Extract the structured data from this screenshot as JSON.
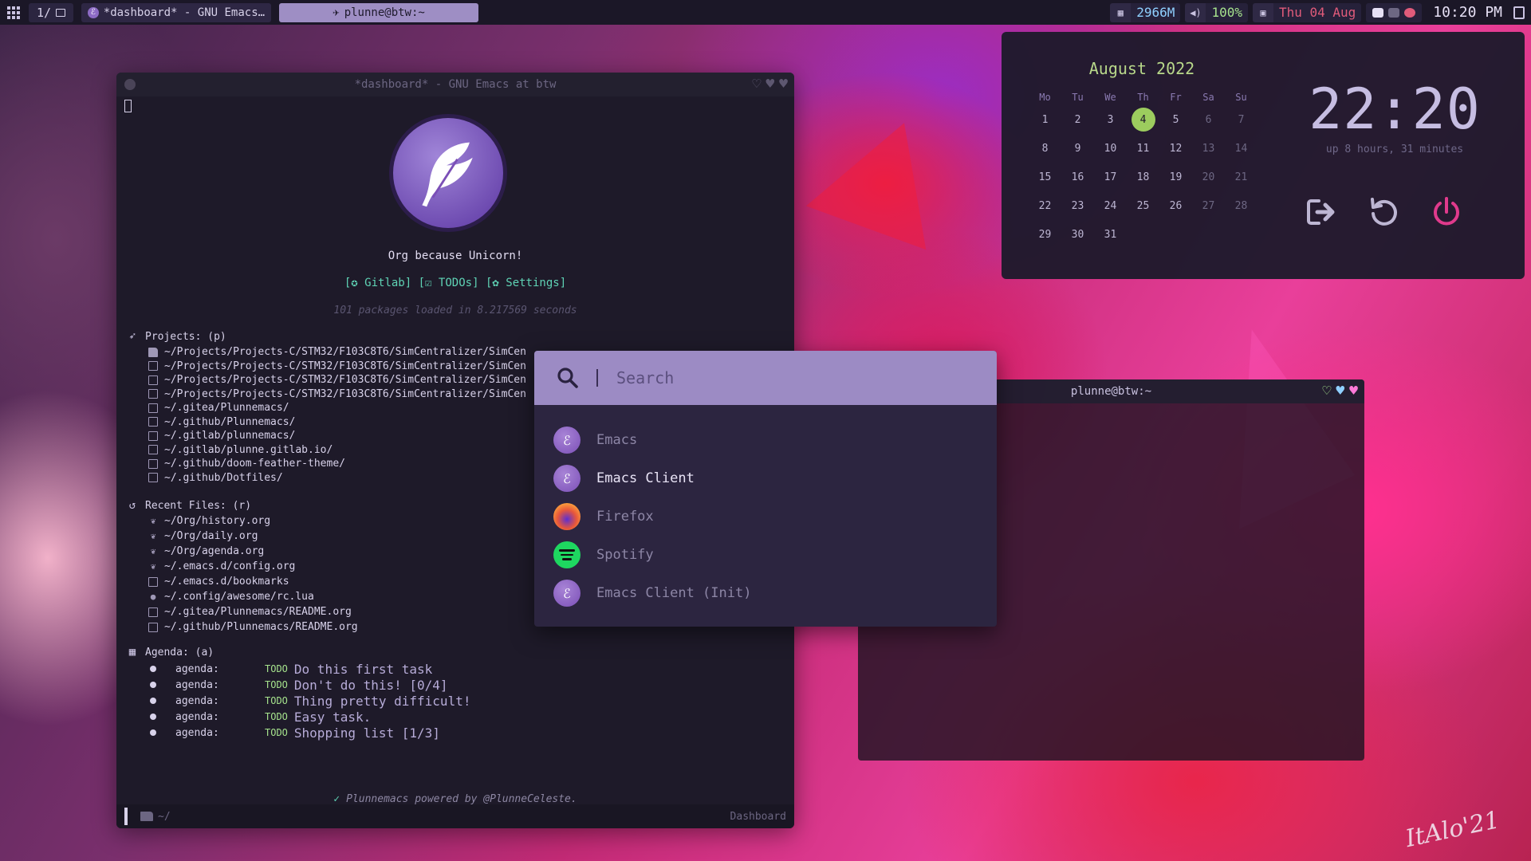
{
  "topbar": {
    "workspace": "1/",
    "tasks": [
      {
        "label": "*dashboard* - GNU Emacs…",
        "active": false
      },
      {
        "label": "plunne@btw:~",
        "active": true
      }
    ],
    "memory": "2966M",
    "volume": "100%",
    "date": "Thu 04 Aug",
    "time": "10:20 PM"
  },
  "emacs": {
    "title": "*dashboard* - GNU Emacs at btw",
    "tagline": "Org because Unicorn!",
    "links": [
      {
        "icon": "gitlab-icon",
        "label": "Gitlab"
      },
      {
        "icon": "check-icon",
        "label": "TODOs"
      },
      {
        "icon": "gear-icon",
        "label": "Settings"
      }
    ],
    "loaded": "101 packages loaded in 8.217569 seconds",
    "projects": {
      "heading": "Projects: (p)",
      "items": [
        "~/Projects/Projects-C/STM32/F103C8T6/SimCentralizer/SimCen",
        "~/Projects/Projects-C/STM32/F103C8T6/SimCentralizer/SimCen",
        "~/Projects/Projects-C/STM32/F103C8T6/SimCentralizer/SimCen",
        "~/Projects/Projects-C/STM32/F103C8T6/SimCentralizer/SimCen",
        "~/.gitea/Plunnemacs/",
        "~/.github/Plunnemacs/",
        "~/.gitlab/plunnemacs/",
        "~/.gitlab/plunne.gitlab.io/",
        "~/.github/doom-feather-theme/",
        "~/.github/Dotfiles/"
      ]
    },
    "recent": {
      "heading": "Recent Files: (r)",
      "items": [
        "~/Org/history.org",
        "~/Org/daily.org",
        "~/Org/agenda.org",
        "~/.emacs.d/config.org",
        "~/.emacs.d/bookmarks",
        "~/.config/awesome/rc.lua",
        "~/.gitea/Plunnemacs/README.org",
        "~/.github/Plunnemacs/README.org"
      ]
    },
    "agenda": {
      "heading": "Agenda: (a)",
      "items": [
        {
          "tag": "agenda:",
          "state": "TODO",
          "text": "Do this first task"
        },
        {
          "tag": "agenda:",
          "state": "TODO",
          "text": "Don't do this! [0/4]"
        },
        {
          "tag": "agenda:",
          "state": "TODO",
          "text": "Thing pretty difficult!"
        },
        {
          "tag": "agenda:",
          "state": "TODO",
          "text": "Easy task."
        },
        {
          "tag": "agenda:",
          "state": "TODO",
          "text": "Shopping list [1/3]"
        }
      ]
    },
    "footer": "Plunnemacs powered by @PlunneCeleste.",
    "modeline": {
      "path": "~/",
      "mode": "Dashboard"
    }
  },
  "terminal": {
    "title": "plunne@btw:~"
  },
  "calendar": {
    "title": "August 2022",
    "weekdays": [
      "Mo",
      "Tu",
      "We",
      "Th",
      "Fr",
      "Sa",
      "Su"
    ],
    "days": [
      "1",
      "2",
      "3",
      "4",
      "5",
      "6",
      "7",
      "8",
      "9",
      "10",
      "11",
      "12",
      "13",
      "14",
      "15",
      "16",
      "17",
      "18",
      "19",
      "20",
      "21",
      "22",
      "23",
      "24",
      "25",
      "26",
      "27",
      "28",
      "29",
      "30",
      "31"
    ],
    "today": "4"
  },
  "clock": {
    "time": "22:20",
    "uptime": "up 8 hours, 31 minutes"
  },
  "launcher": {
    "placeholder": "Search",
    "apps": [
      {
        "name": "Emacs",
        "icon": "emacs-icon",
        "selected": false
      },
      {
        "name": "Emacs Client",
        "icon": "emacs-icon",
        "selected": true
      },
      {
        "name": "Firefox",
        "icon": "firefox-icon",
        "selected": false
      },
      {
        "name": "Spotify",
        "icon": "spotify-icon",
        "selected": false
      },
      {
        "name": "Emacs Client (Init)",
        "icon": "emacs-icon",
        "selected": false
      }
    ]
  },
  "colors": {
    "accent": "#9c8bc4",
    "todo": "#a6e38d",
    "link": "#5fd3b5",
    "power": "#e03a8c",
    "today": "#9ccc5e"
  }
}
